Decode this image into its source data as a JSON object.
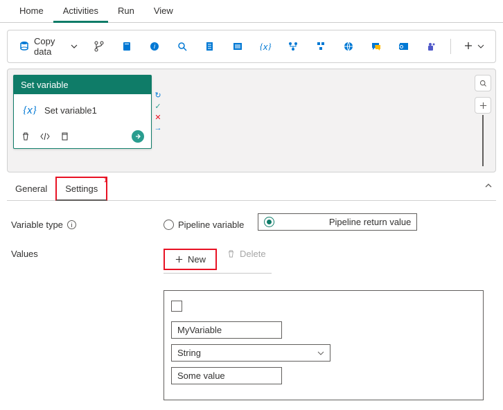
{
  "topnav": {
    "tabs": [
      {
        "label": "Home"
      },
      {
        "label": "Activities"
      },
      {
        "label": "Run"
      },
      {
        "label": "View"
      }
    ],
    "active": "Activities"
  },
  "toolbar": {
    "copy_label": "Copy data"
  },
  "node": {
    "title": "Set variable",
    "name": "Set variable1"
  },
  "tabbar": {
    "tabs": [
      {
        "label": "General"
      },
      {
        "label": "Settings",
        "badge": "1",
        "active": true
      }
    ]
  },
  "form": {
    "variable_type_label": "Variable type",
    "values_label": "Values",
    "radio1": "Pipeline variable",
    "radio2": "Pipeline return value",
    "new_label": "New",
    "delete_label": "Delete"
  },
  "panel": {
    "name_value": "MyVariable",
    "type_value": "String",
    "value_value": "Some value"
  }
}
